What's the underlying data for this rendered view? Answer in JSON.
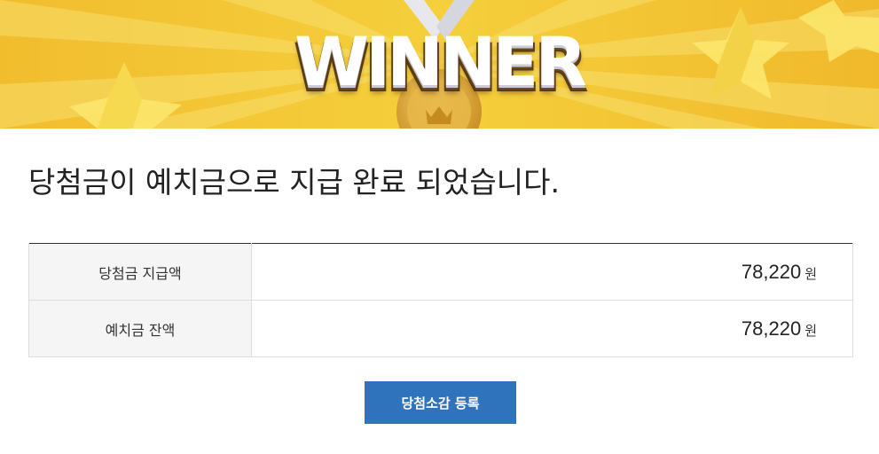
{
  "banner": {
    "title": "WINNER",
    "colors": {
      "background": "#f3c93a",
      "ray": "#f8dc63",
      "star": "#fbe668",
      "medal": "#d9a02c",
      "ribbon": "#e9e9ee"
    },
    "icons": [
      "star-icon",
      "medal-icon",
      "crown-icon"
    ]
  },
  "headline": "당첨금이 예치금으로 지급 완료 되었습니다.",
  "rows": [
    {
      "label": "당첨금 지급액",
      "amount": "78,220",
      "unit": "원"
    },
    {
      "label": "예치금 잔액",
      "amount": "78,220",
      "unit": "원"
    }
  ],
  "button": {
    "label": "당첨소감 등록",
    "color": "#2f73bd"
  }
}
